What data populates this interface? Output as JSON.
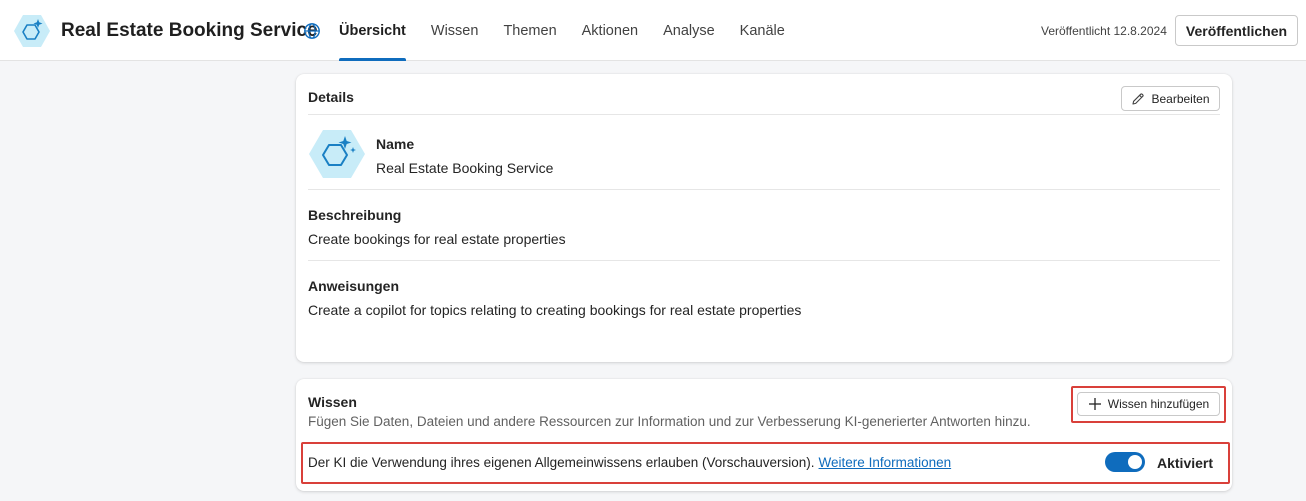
{
  "header": {
    "app_title": "Real Estate Booking Service",
    "tabs": [
      {
        "label": "Übersicht",
        "active": true
      },
      {
        "label": "Wissen",
        "active": false
      },
      {
        "label": "Themen",
        "active": false
      },
      {
        "label": "Aktionen",
        "active": false
      },
      {
        "label": "Analyse",
        "active": false
      },
      {
        "label": "Kanäle",
        "active": false
      }
    ],
    "published_status": "Veröffentlicht 12.8.2024",
    "publish_label": "Veröffentlichen"
  },
  "details": {
    "title": "Details",
    "edit_label": "Bearbeiten",
    "name_label": "Name",
    "name_value": "Real Estate Booking Service",
    "description_label": "Beschreibung",
    "description_value": "Create bookings for real estate properties",
    "instructions_label": "Anweisungen",
    "instructions_value": "Create a copilot for topics relating to creating bookings for real estate properties"
  },
  "knowledge": {
    "title": "Wissen",
    "description": "Fügen Sie Daten, Dateien und andere Ressourcen zur Information und zur Verbesserung KI-generierter Antworten hinzu.",
    "add_label": "Wissen hinzufügen",
    "ai_general_text": "Der KI die Verwendung ihres eigenen Allgemeinwissens erlauben (Vorschauversion).",
    "more_info_link": "Weitere Informationen",
    "toggle_on": true,
    "toggle_label": "Aktiviert"
  },
  "icons": {
    "logo": "copilot-hexagon-sparkle-icon",
    "globe": "globe-icon",
    "edit": "pencil-icon",
    "add": "plus-icon"
  },
  "colors": {
    "accent": "#0f6cbd",
    "highlight": "#d9403a",
    "icon_hex_fill": "#c8ecf8",
    "icon_stroke": "#1a80c4"
  }
}
